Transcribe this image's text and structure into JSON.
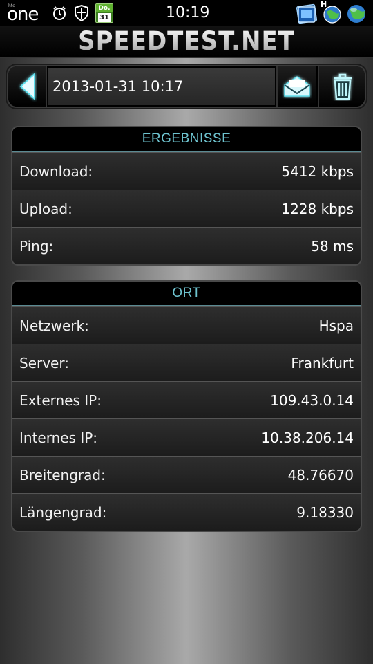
{
  "status_bar": {
    "brand_small": "htc",
    "brand": "one",
    "calendar_day": "Do.",
    "calendar_date": "31",
    "time": "10:19",
    "network_letter": "H"
  },
  "header": {
    "logo": "SPEEDTEST.NET"
  },
  "action_bar": {
    "date": "2013-01-31 10:17"
  },
  "results": {
    "title": "ERGEBNISSE",
    "rows": [
      {
        "label": "Download:",
        "value": "5412 kbps"
      },
      {
        "label": "Upload:",
        "value": "1228 kbps"
      },
      {
        "label": "Ping:",
        "value": "58 ms"
      }
    ]
  },
  "location": {
    "title": "ORT",
    "rows": [
      {
        "label": "Netzwerk:",
        "value": "Hspa"
      },
      {
        "label": "Server:",
        "value": "Frankfurt"
      },
      {
        "label": "Externes IP:",
        "value": "109.43.0.14"
      },
      {
        "label": "Internes IP:",
        "value": "10.38.206.14"
      },
      {
        "label": "Breitengrad:",
        "value": "48.76670"
      },
      {
        "label": "Längengrad:",
        "value": "9.18330"
      }
    ]
  },
  "colors": {
    "accent": "#6ec3cf",
    "icon_glow": "#5fe0ee",
    "background_center": "#a9a9a9"
  }
}
